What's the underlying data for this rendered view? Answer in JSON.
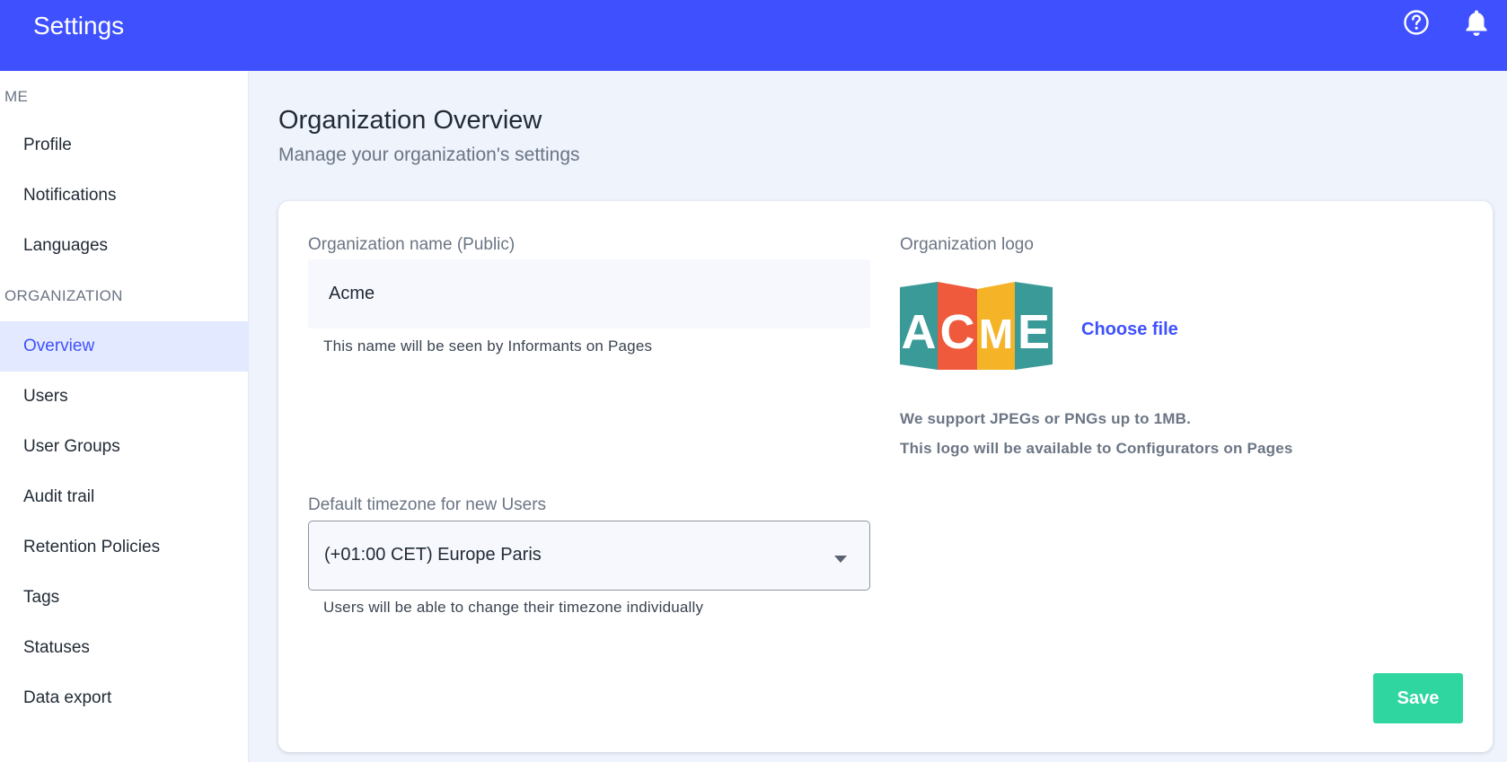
{
  "header": {
    "title": "Settings",
    "help_icon": "help-circle-icon",
    "notifications_icon": "bell-icon",
    "background": "#3f51fe"
  },
  "sidebar": {
    "sections": [
      {
        "label": "ME",
        "items": [
          "Profile",
          "Notifications",
          "Languages"
        ]
      },
      {
        "label": "ORGANIZATION",
        "items": [
          "Overview",
          "Users",
          "User Groups",
          "Audit trail",
          "Retention Policies",
          "Tags",
          "Statuses",
          "Data export"
        ]
      }
    ],
    "active_item": "Overview",
    "active_color": "#3f51fe"
  },
  "main": {
    "title": "Organization Overview",
    "subtitle": "Manage your organization's settings"
  },
  "form": {
    "org_name": {
      "label": "Organization name (Public)",
      "value": "Acme",
      "hint": "This name will be seen by Informants on Pages"
    },
    "timezone": {
      "label": "Default timezone for new Users",
      "value": "(+01:00 CET) Europe Paris",
      "hint": "Users will be able to change their timezone individually"
    },
    "logo": {
      "label": "Organization logo",
      "logo_letters": [
        "A",
        "C",
        "M",
        "E"
      ],
      "logo_colors": [
        "#3a9a97",
        "#ee5a3b",
        "#f5b428",
        "#3a9a97"
      ],
      "choose_file": "Choose file",
      "note_1": "We support JPEGs or PNGs up to 1MB.",
      "note_2": "This logo will be available to Configurators on Pages"
    },
    "save_label": "Save",
    "save_color": "#2fd6a0"
  }
}
